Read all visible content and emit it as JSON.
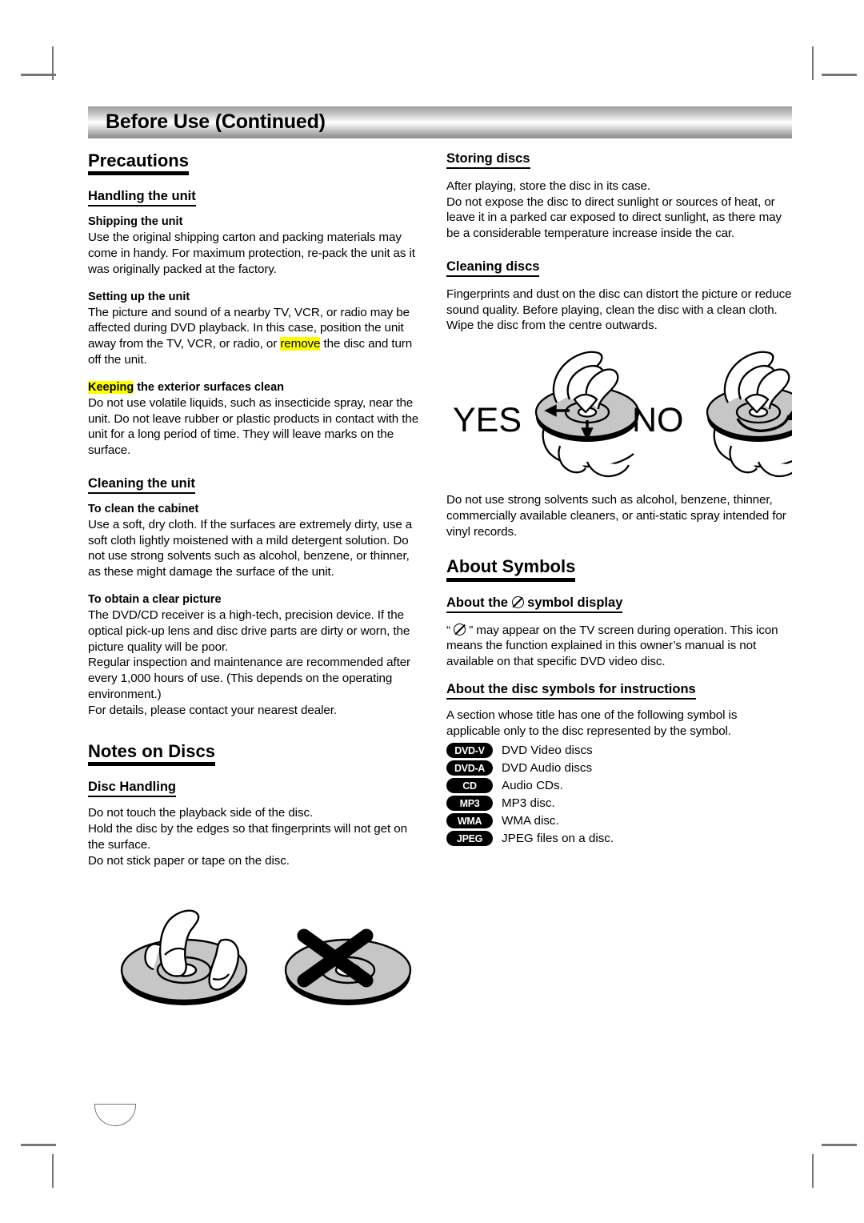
{
  "header": {
    "title": "Before Use (Continued)"
  },
  "left_column": {
    "precautions_heading": "Precautions",
    "handling_heading": "Handling the unit",
    "shipping": {
      "title": "Shipping the unit",
      "body": "Use the original shipping carton and packing materials may come in handy. For maximum protection, re-pack the unit as it was originally packed at the factory."
    },
    "setting_up": {
      "title": "Setting up the unit",
      "body_before": "The picture and sound of a nearby TV, VCR, or radio may be affected during DVD playback. In this case, position the unit away from the TV, VCR, or radio, or ",
      "highlight": "remove",
      "body_after": " the disc and turn off the unit."
    },
    "keeping_clean": {
      "title_highlight": "Keeping",
      "title_rest": " the exterior surfaces clean",
      "body": "Do not use volatile liquids, such as insecticide spray, near the unit. Do not leave rubber or plastic products in contact with the unit for a long period of time. They will leave marks on the surface."
    },
    "cleaning_heading": "Cleaning the unit",
    "clean_cabinet": {
      "title": "To clean the cabinet",
      "body": "Use a soft, dry cloth. If the surfaces are extremely dirty, use a soft cloth lightly moistened with a mild detergent solution. Do not use strong solvents such as alcohol, benzene, or thinner, as these might damage the surface of the unit."
    },
    "clear_picture": {
      "title": "To obtain a clear picture",
      "body1": "The DVD/CD receiver is a high-tech, precision device. If the optical pick-up lens and disc drive parts are dirty or worn, the picture quality will be poor.",
      "body2": "Regular inspection and maintenance are recommended after every 1,000 hours of use. (This depends on the operating environment.)",
      "body3": "For details, please contact your nearest dealer."
    },
    "notes_heading": "Notes on Discs",
    "disc_handling": {
      "title": "Disc Handling",
      "line1": "Do not touch the playback side of the disc.",
      "line2": "Hold the disc by the edges so that fingerprints will not get on the surface.",
      "line3": "Do not stick paper or tape on the disc."
    }
  },
  "right_column": {
    "storing": {
      "title": "Storing discs",
      "line1": "After playing, store the disc in its case.",
      "line2": "Do not expose the disc to direct sunlight or sources of heat, or leave it in a parked car exposed to direct sunlight, as there may be a considerable temperature increase inside the car."
    },
    "cleaning_discs": {
      "title": "Cleaning discs",
      "body": "Fingerprints and dust on the disc can distort the picture or reduce sound quality. Before playing, clean the disc with a clean cloth. Wipe the disc from the centre outwards."
    },
    "figure_labels": {
      "yes": "YES",
      "no": "NO"
    },
    "solvents_note": "Do not use strong solvents such as alcohol, benzene, thinner, commercially available cleaners, or anti-static spray intended for vinyl records.",
    "about_symbols_heading": "About Symbols",
    "symbol_display": {
      "title_before": "About the ",
      "title_after": " symbol display",
      "body_before": "“",
      "body_after": " ” may appear on the TV screen during operation. This icon means the function explained in this owner’s manual is not available on that specific DVD video disc."
    },
    "disc_symbols": {
      "title": "About the disc symbols for instructions",
      "intro": "A section whose title has one of the following symbol is applicable only to the disc represented by the symbol.",
      "items": [
        {
          "badge": "DVD-V",
          "label": "DVD Video discs"
        },
        {
          "badge": "DVD-A",
          "label": "DVD Audio discs"
        },
        {
          "badge": "CD",
          "label": "Audio CDs."
        },
        {
          "badge": "MP3",
          "label": "MP3 disc."
        },
        {
          "badge": "WMA",
          "label": "WMA disc."
        },
        {
          "badge": "JPEG",
          "label": "JPEG files on a disc."
        }
      ]
    }
  },
  "colors": {
    "highlight": "#ffff00",
    "disc_gray": "#c6c6c6",
    "crop_mark": "#777777"
  }
}
